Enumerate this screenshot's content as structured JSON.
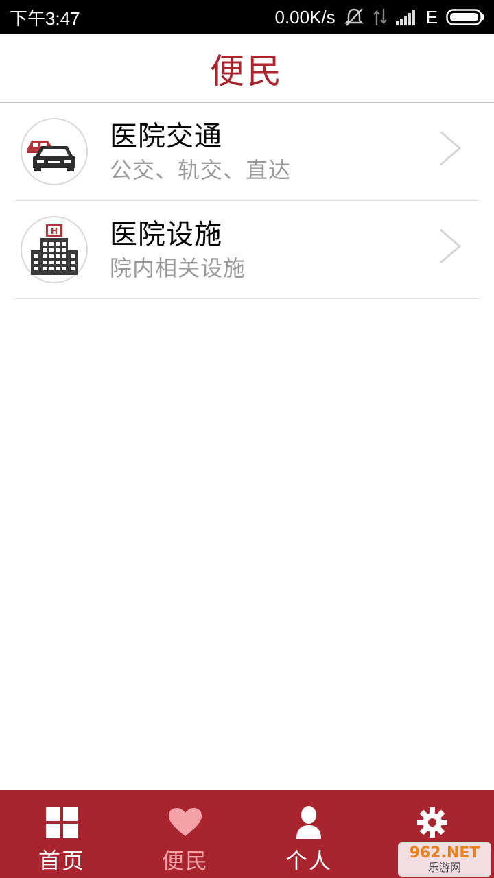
{
  "status_bar": {
    "time": "下午3:47",
    "net_speed": "0.00K/s",
    "network_type": "E",
    "icons": [
      "alarm-off-icon",
      "data-arrows-icon",
      "signal-icon",
      "battery-icon"
    ]
  },
  "header": {
    "title": "便民"
  },
  "list": {
    "items": [
      {
        "title": "医院交通",
        "subtitle": "公交、轨交、直达",
        "icon": "car-icon"
      },
      {
        "title": "医院设施",
        "subtitle": "院内相关设施",
        "icon": "hospital-building-icon"
      }
    ]
  },
  "tabs": {
    "items": [
      {
        "label": "首页",
        "icon": "grid-icon",
        "active": false
      },
      {
        "label": "便民",
        "icon": "heart-icon",
        "active": true
      },
      {
        "label": "个人",
        "icon": "person-icon",
        "active": false
      },
      {
        "label": "",
        "icon": "gear-icon",
        "active": false
      }
    ]
  },
  "watermark": {
    "top": "962.NET",
    "bottom": "乐游网"
  },
  "colors": {
    "brand": "#a8252f",
    "active_tab": "#f4a1a8",
    "subtitle": "#9a9a9a"
  }
}
